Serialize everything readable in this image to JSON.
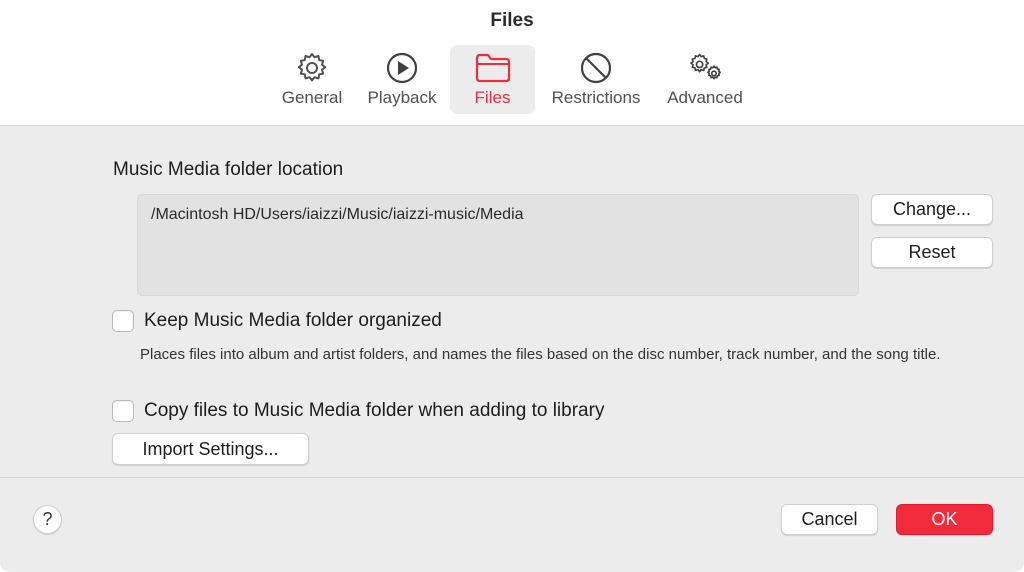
{
  "window": {
    "title": "Files"
  },
  "tabs": [
    {
      "label": "General",
      "icon": "gear-icon"
    },
    {
      "label": "Playback",
      "icon": "play-circle-icon"
    },
    {
      "label": "Files",
      "icon": "folder-icon",
      "active": true
    },
    {
      "label": "Restrictions",
      "icon": "prohibited-icon"
    },
    {
      "label": "Advanced",
      "icon": "gears-icon"
    }
  ],
  "files": {
    "location_label": "Music Media folder location",
    "path": "/Macintosh HD/Users/iaizzi/Music/iaizzi-music/Media",
    "change_button": "Change...",
    "reset_button": "Reset",
    "keep_organized": {
      "label": "Keep Music Media folder organized",
      "checked": false,
      "description": "Places files into album and artist folders, and names the files based on the disc number, track number, and the song title."
    },
    "copy_files": {
      "label": "Copy files to Music Media folder when adding to library",
      "checked": false
    },
    "import_settings_button": "Import Settings..."
  },
  "footer": {
    "help_label": "?",
    "cancel_button": "Cancel",
    "ok_button": "OK"
  },
  "colors": {
    "accent": "#e8303f",
    "ok_button": "#f02c3c"
  }
}
